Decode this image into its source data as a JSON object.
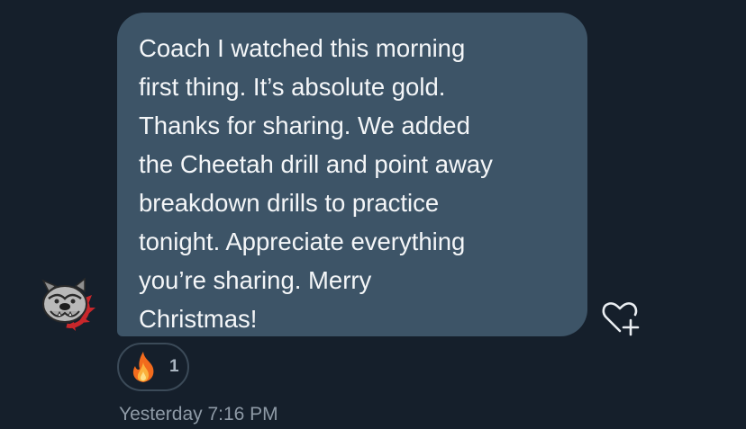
{
  "message": {
    "text": "Coach I watched this morning\nfirst thing. It’s absolute gold.\nThanks for sharing. We added\nthe Cheetah drill and point away\nbreakdown drills to practice\ntonight. Appreciate everything\nyou’re sharing. Merry\nChristmas!"
  },
  "reaction": {
    "emoji_icon": "fire-icon",
    "count": "1"
  },
  "timestamp": "Yesterday 7:16 PM",
  "avatar_icon": "bulldog-logo-icon",
  "add_reaction_icon": "heart-plus-icon",
  "colors": {
    "background": "#151f2b",
    "bubble": "#3d5467",
    "text": "#f4f6f8",
    "muted": "#8e9aa6"
  }
}
